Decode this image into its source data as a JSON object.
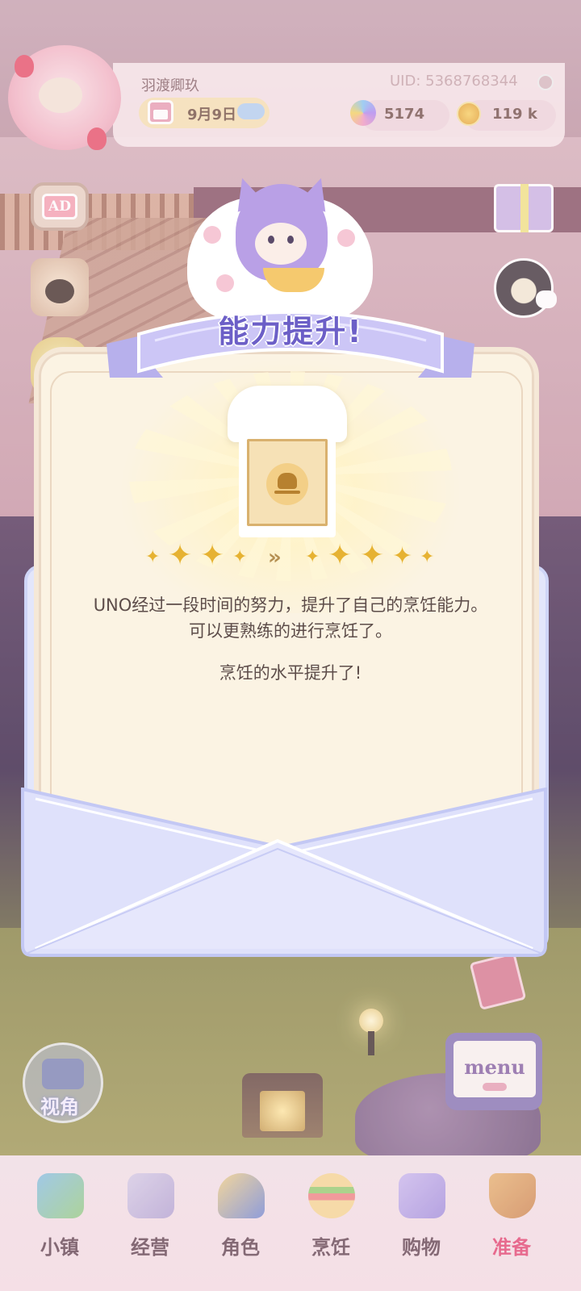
{
  "hud": {
    "player_name": "羽渡卿玖",
    "uid": "UID: 5368768344",
    "date": "9月9日",
    "gems": "5174",
    "coins": "119 k"
  },
  "side": {
    "ad_label": "AD",
    "camera_label": "视角",
    "menu_label": "menu"
  },
  "popup": {
    "title": "能力提升!",
    "message_line1": "UNO经过一段时间的努力，提升了自己的烹饪能力。",
    "message_line2": "可以更熟练的进行烹饪了。",
    "message_line3": "烹饪的水平提升了!",
    "stars_before": 4,
    "stars_after": 5,
    "arrow": "»"
  },
  "nav": {
    "items": [
      {
        "label": "小镇",
        "icon": "town-map-icon"
      },
      {
        "label": "经营",
        "icon": "shop-bag-lock-icon"
      },
      {
        "label": "角色",
        "icon": "character-icon"
      },
      {
        "label": "烹饪",
        "icon": "sandwich-icon"
      },
      {
        "label": "购物",
        "icon": "shopping-bag-icon"
      },
      {
        "label": "准备",
        "icon": "picnic-basket-icon"
      }
    ],
    "accent_color": "#e4507a"
  },
  "colors": {
    "ribbon": "#c9c3f2",
    "title_text": "#6c5fc7",
    "card_bg": "#fbf3e3",
    "envelope": "#dfe2fb",
    "star": "#e6b232"
  }
}
